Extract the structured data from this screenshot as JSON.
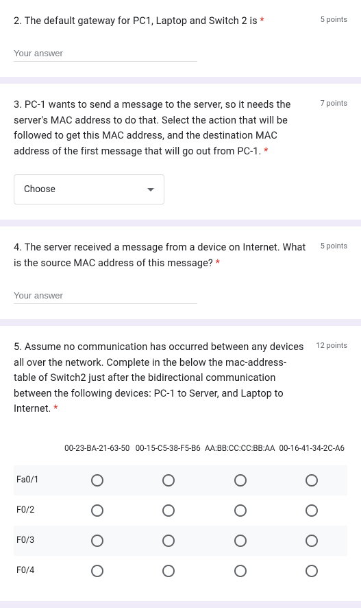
{
  "q2": {
    "text": "2. The default gateway for PC1, Laptop and Switch 2 is ",
    "points": "5 points",
    "placeholder": "Your answer"
  },
  "q3": {
    "text": "3. PC-1 wants to send a message to the server, so it needs the server's MAC address to do that. Select the action that will be followed to get this MAC address, and the destination MAC address of the first message that will go out from PC-1. ",
    "points": "7 points",
    "choose": "Choose"
  },
  "q4": {
    "text": "4. The server received a message from a device on Internet. What is the source MAC address of this message? ",
    "points": "5 points",
    "placeholder": "Your answer"
  },
  "q5": {
    "text": "5. Assume no communication has occurred between any devices all over the network. Complete in the below the mac-address-table of Switch2 just after the bidirectional communication between the following devices: PC-1 to Server, and Laptop to Internet. ",
    "points": "12 points",
    "cols": [
      "00-23-BA-21-63-50",
      "00-15-C5-38-F5-B6",
      "AA:BB:CC:CC:BB:AA",
      "00-16-41-34-2C-A6"
    ],
    "rows": [
      "Fa0/1",
      "F0/2",
      "F0/3",
      "F0/4"
    ]
  },
  "required_mark": "*",
  "chart_data": {
    "type": "table",
    "columns": [
      "00-23-BA-21-63-50",
      "00-15-C5-38-F5-B6",
      "AA:BB:CC:CC:BB:AA",
      "00-16-41-34-2C-A6"
    ],
    "rows": [
      "Fa0/1",
      "F0/2",
      "F0/3",
      "F0/4"
    ],
    "values": [
      [
        null,
        null,
        null,
        null
      ],
      [
        null,
        null,
        null,
        null
      ],
      [
        null,
        null,
        null,
        null
      ],
      [
        null,
        null,
        null,
        null
      ]
    ]
  }
}
